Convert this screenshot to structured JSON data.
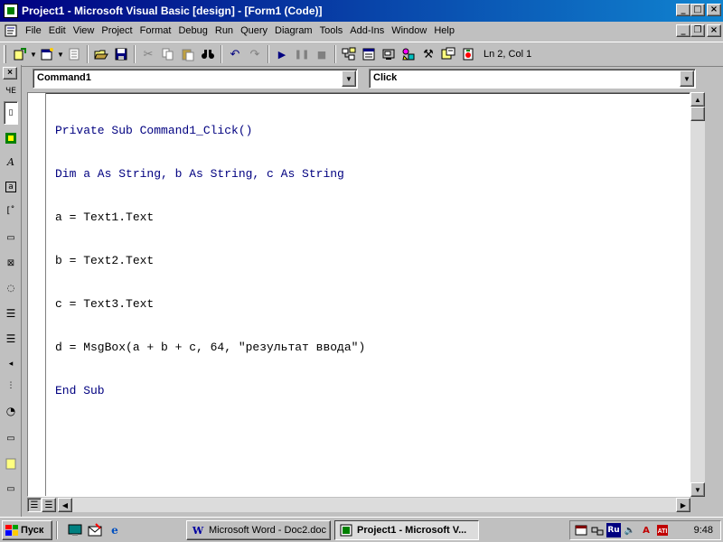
{
  "window": {
    "title": "Project1 - Microsoft Visual Basic [design] - [Form1 (Code)]",
    "controls": {
      "minimize": "_",
      "maximize": "□",
      "close": "×",
      "restore": "❐"
    }
  },
  "menu": {
    "items": [
      "File",
      "Edit",
      "View",
      "Project",
      "Format",
      "Debug",
      "Run",
      "Query",
      "Diagram",
      "Tools",
      "Add-Ins",
      "Window",
      "Help"
    ]
  },
  "toolbar": {
    "position": "Ln 2, Col 1",
    "icons": [
      "add-project-icon",
      "add-form-icon",
      "menu-editor-icon",
      "open-icon",
      "save-icon",
      "cut-icon",
      "copy-icon",
      "paste-icon",
      "find-icon",
      "undo-icon",
      "redo-icon",
      "start-icon",
      "break-icon",
      "end-icon",
      "project-explorer-icon",
      "properties-window-icon",
      "form-layout-icon",
      "object-browser-icon",
      "toolbox-icon",
      "data-view-icon",
      "component-manager-icon"
    ]
  },
  "code_window": {
    "object_combo": "Command1",
    "procedure_combo": "Click",
    "lines": [
      "Private Sub Command1_Click()",
      "Dim a As String, b As String, c As String",
      "a = Text1.Text",
      "b = Text2.Text",
      "c = Text3.Text",
      "d = MsgBox(a + b + c, 64, \"результат ввода\")",
      "End Sub"
    ]
  },
  "toolbox": {
    "close": "×",
    "tools": [
      "pointer-icon",
      "picturebox-icon",
      "label-icon",
      "textbox-icon",
      "frame-icon",
      "commandbutton-icon",
      "checkbox-icon",
      "optionbutton-icon",
      "combobox-icon",
      "listbox-icon",
      "hscrollbar-icon",
      "vscrollbar-icon",
      "timer-icon",
      "drivelistbox-icon",
      "dirlistbox-icon",
      "filelistbox-icon",
      "shape-icon",
      "line-icon",
      "image-icon",
      "data-icon",
      "ole-icon"
    ]
  },
  "taskbar": {
    "start_label": "Пуск",
    "tasks": [
      {
        "label": "Microsoft Word - Doc2.doc",
        "icon": "W",
        "active": false
      },
      {
        "label": "Project1 - Microsoft V...",
        "icon": "vb",
        "active": true
      }
    ],
    "tray": {
      "lang": "Ru",
      "clock": "9:48"
    }
  }
}
